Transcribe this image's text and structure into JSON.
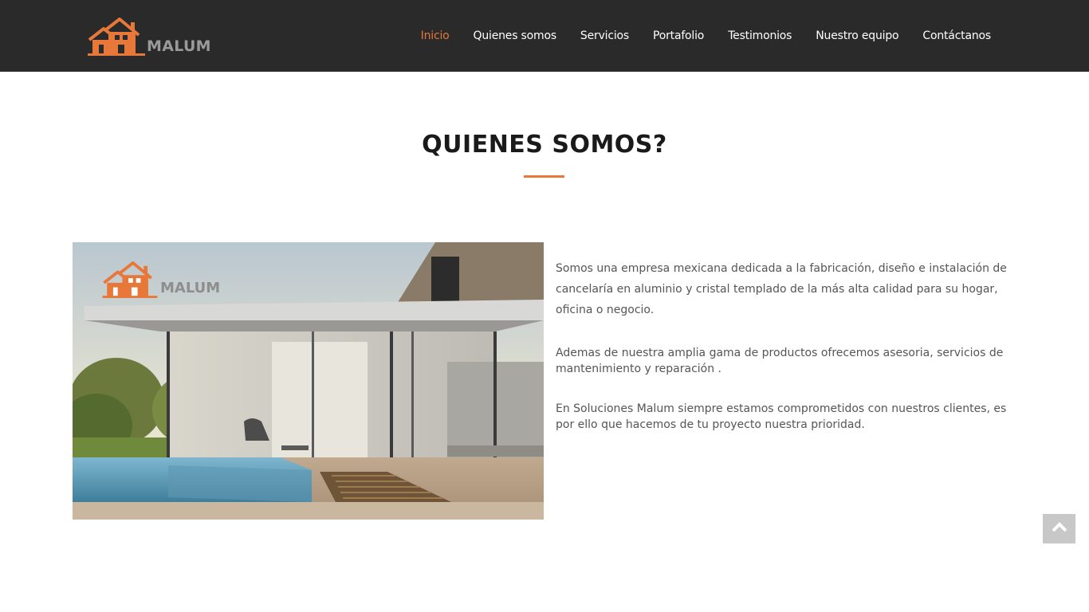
{
  "header": {
    "brand": "MALUM",
    "nav": [
      {
        "label": "Inicio",
        "active": true
      },
      {
        "label": "Quienes somos",
        "active": false
      },
      {
        "label": "Servicios",
        "active": false
      },
      {
        "label": "Portafolio",
        "active": false
      },
      {
        "label": "Testimonios",
        "active": false
      },
      {
        "label": "Nuestro equipo",
        "active": false
      },
      {
        "label": "Contáctanos",
        "active": false
      }
    ]
  },
  "about": {
    "title": "QUIENES SOMOS?",
    "image_logo": "MALUM",
    "paragraphs": [
      "Somos una empresa mexicana dedicada a la fabricación, diseño e instalación de cancelaría en aluminio y cristal templado de la más alta calidad para su hogar, oficina o negocio.",
      "Ademas de nuestra amplia gama de productos ofrecemos asesoria, servicios de mantenimiento y reparación .",
      "En Soluciones Malum siempre estamos comprometidos con nuestros clientes, es por ello que hacemos de tu proyecto nuestra prioridad."
    ]
  },
  "colors": {
    "accent": "#e8773a",
    "header_bg": "#2a2a2a"
  },
  "icons": {
    "logo": "house-logo-icon",
    "scroll_top": "chevron-up-icon"
  }
}
